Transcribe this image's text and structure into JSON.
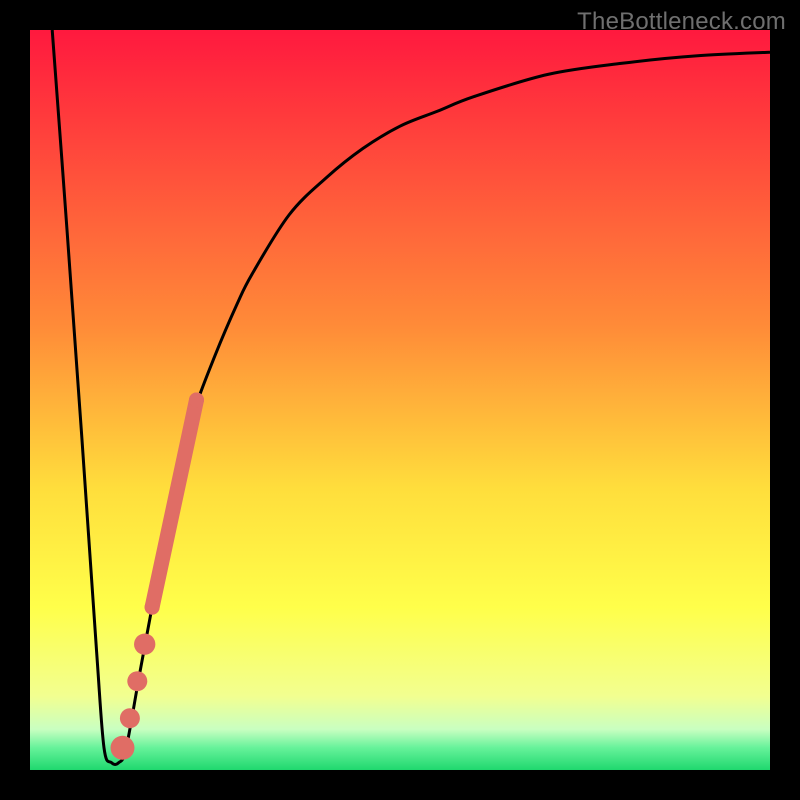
{
  "watermark": "TheBottleneck.com",
  "colors": {
    "frame": "#000000",
    "curve": "#000000",
    "marker": "#e06d65",
    "gradient_top": "#ff193e",
    "gradient_mid1": "#ffa23a",
    "gradient_mid2": "#ffff4a",
    "gradient_mid3": "#f2ff90",
    "gradient_bottom": "#28e47a"
  },
  "chart_data": {
    "type": "line",
    "title": "",
    "xlabel": "",
    "ylabel": "",
    "xlim": [
      0,
      100
    ],
    "ylim": [
      0,
      100
    ],
    "grid": false,
    "legend": false,
    "series": [
      {
        "name": "bottleneck-curve",
        "x": [
          3,
          5,
          7,
          9,
          10,
          11,
          12,
          13,
          15,
          18,
          20,
          22,
          25,
          28,
          30,
          35,
          40,
          45,
          50,
          55,
          60,
          70,
          80,
          90,
          100
        ],
        "y": [
          100,
          73,
          45,
          16,
          3,
          1,
          1,
          3,
          14,
          30,
          40,
          48,
          56,
          63,
          67,
          75,
          80,
          84,
          87,
          89,
          91,
          94,
          95.5,
          96.5,
          97
        ]
      }
    ],
    "markers": [
      {
        "name": "highlight-band-start",
        "x": 16.5,
        "y": 22,
        "r": 1.2
      },
      {
        "name": "highlight-band-end",
        "x": 22.5,
        "y": 50,
        "r": 1.2
      },
      {
        "name": "point-a",
        "x": 15.5,
        "y": 17,
        "r": 1.0
      },
      {
        "name": "point-b",
        "x": 14.5,
        "y": 12,
        "r": 0.9
      },
      {
        "name": "point-c",
        "x": 13.5,
        "y": 7,
        "r": 0.9
      },
      {
        "name": "point-d",
        "x": 12.5,
        "y": 3,
        "r": 1.2
      }
    ],
    "gradient_stops": [
      {
        "offset": 0.0,
        "color": "#ff193e"
      },
      {
        "offset": 0.4,
        "color": "#ff8b38"
      },
      {
        "offset": 0.62,
        "color": "#ffde3c"
      },
      {
        "offset": 0.78,
        "color": "#ffff4a"
      },
      {
        "offset": 0.9,
        "color": "#f2ff90"
      },
      {
        "offset": 0.945,
        "color": "#c9ffc1"
      },
      {
        "offset": 0.97,
        "color": "#66f29a"
      },
      {
        "offset": 1.0,
        "color": "#1fd86e"
      }
    ]
  }
}
